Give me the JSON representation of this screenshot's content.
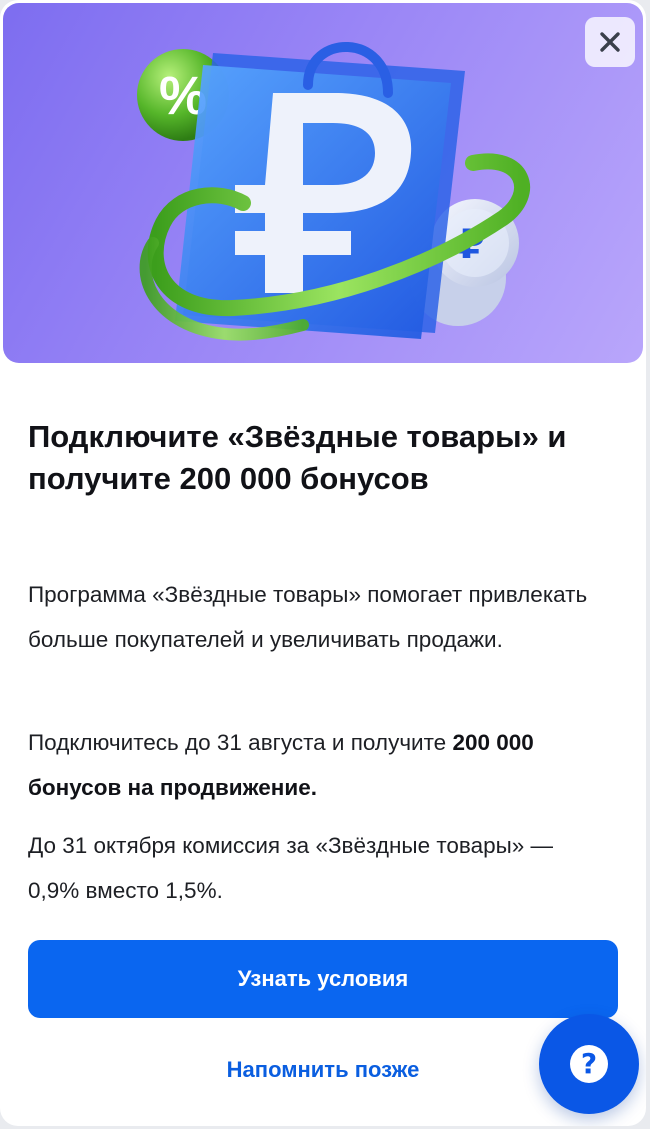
{
  "dialog": {
    "title": "Подключите «Звёздные товары» и получите 200 000 бонусов",
    "paragraph_1": "Программа «Звёздные товары» помогает привлекать больше покупателей и увеличивать продажи.",
    "paragraph_2_text": "Подключитесь до 31 августа и получите ",
    "paragraph_2_bold": "200 000 бонусов на продвижение.",
    "paragraph_3": "До 31 октября комиссия за «Звёздные товары» — 0,9% вместо 1,5%.",
    "primary_button_label": "Узнать условия",
    "secondary_button_label": "Напомнить позже"
  },
  "banner": {
    "percent_symbol": "%",
    "coin_symbol": "₽",
    "icon": "ruble-shopping-bag-illustration"
  },
  "help_button": {
    "symbol": "?",
    "icon": "help-icon"
  },
  "close_button": {
    "icon": "close-icon"
  },
  "colors": {
    "primary": "#0a66f0",
    "link": "#0a5ee0",
    "banner_start": "#7d6df0",
    "banner_end": "#b9a6fb",
    "title": "#111217"
  }
}
